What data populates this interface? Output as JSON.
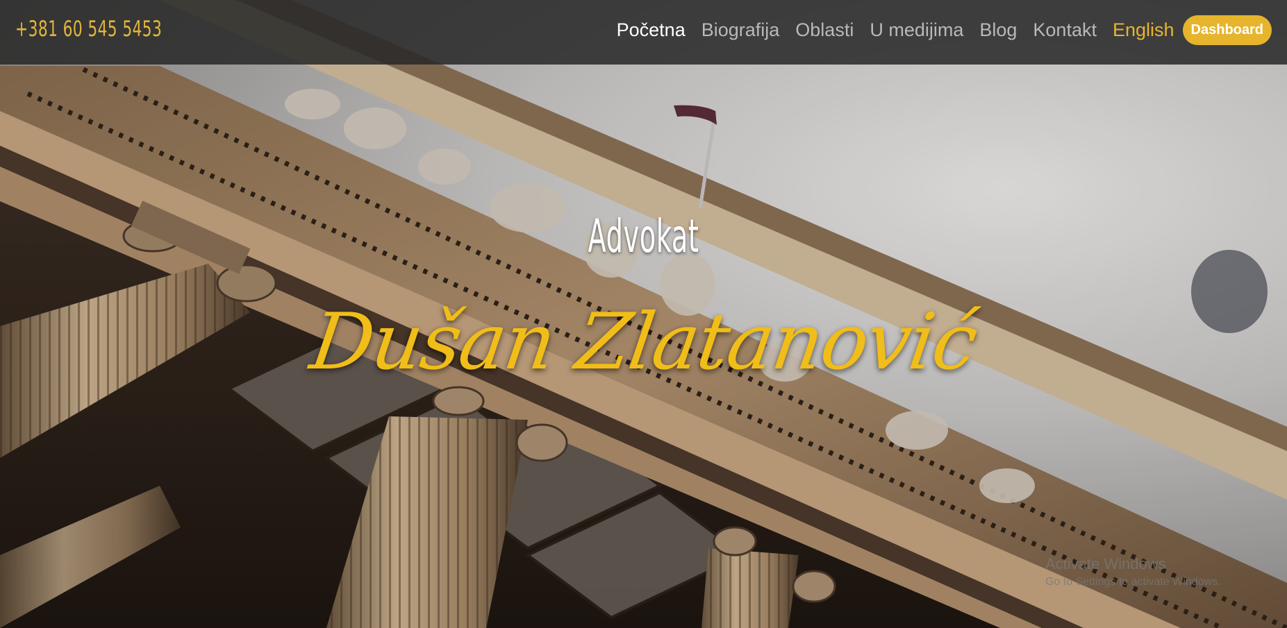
{
  "header": {
    "phone": "+381 60 545 5453",
    "nav": {
      "home": "Početna",
      "biography": "Biografija",
      "areas": "Oblasti",
      "media": "U medijima",
      "blog": "Blog",
      "contact": "Kontakt",
      "language": "English",
      "dashboard": "Dashboard"
    }
  },
  "hero": {
    "subtitle": "Advokat",
    "name": "Dušan Zlatanović"
  },
  "watermark": {
    "title": "Activate Windows",
    "subtitle": "Go to Settings to activate Windows."
  },
  "colors": {
    "accent": "#e6b52d",
    "nav_bar": "#282828",
    "name_gold": "#f1bd18"
  }
}
